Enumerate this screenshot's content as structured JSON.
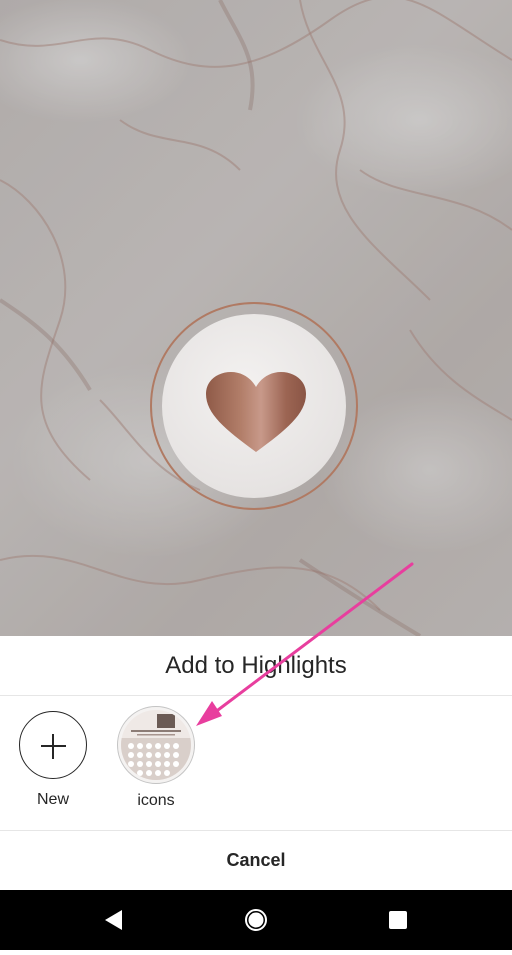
{
  "sheet": {
    "title": "Add to Highlights",
    "new_label": "New",
    "highlights": [
      {
        "label": "icons"
      }
    ],
    "cancel_label": "Cancel"
  },
  "icons": {
    "plus": "plus-icon",
    "heart": "heart-icon",
    "back": "triangle-back-icon",
    "home": "circle-home-icon",
    "recents": "square-recents-icon"
  },
  "colors": {
    "accent_rose_gold": "#b07a63",
    "annotation_arrow": "#e83e9e",
    "text": "#262626",
    "nav_bar": "#000000"
  }
}
